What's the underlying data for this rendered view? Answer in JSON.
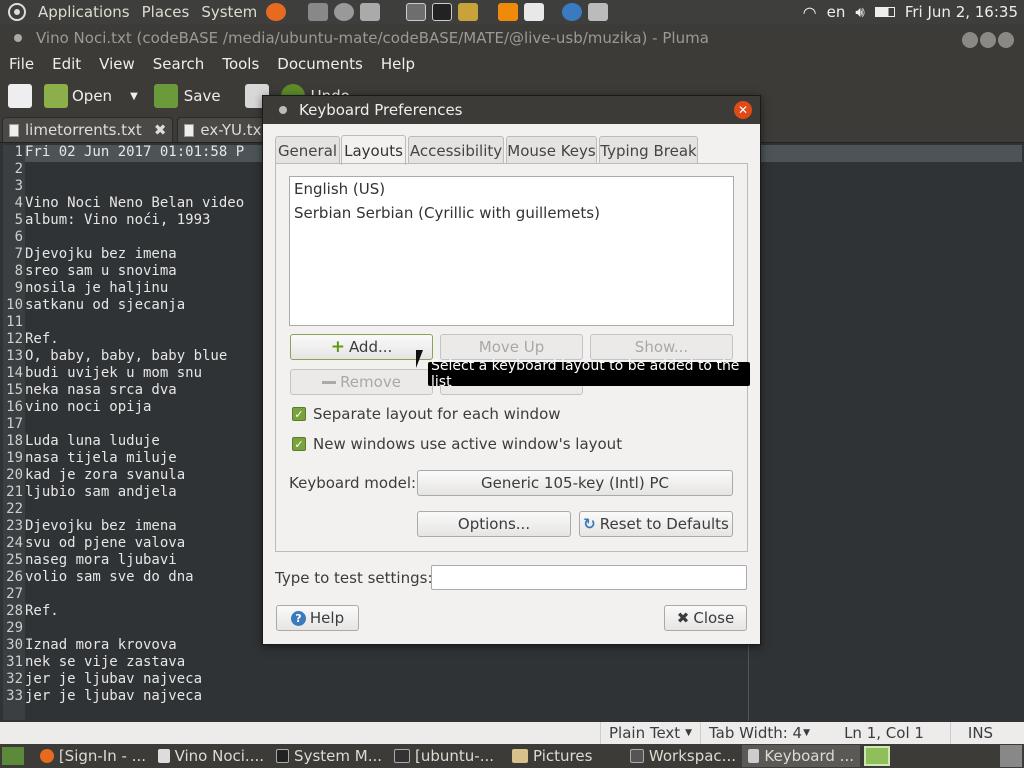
{
  "top_panel": {
    "menus": [
      "Applications",
      "Places",
      "System"
    ],
    "keyboard_layout": "en",
    "clock": "Fri Jun 2, 16:35"
  },
  "window": {
    "title": "Vino Noci.txt (codeBASE /media/ubuntu-mate/codeBASE/MATE/@live-usb/muzika) - Pluma",
    "menu": [
      "File",
      "Edit",
      "View",
      "Search",
      "Tools",
      "Documents",
      "Help"
    ],
    "toolbar": {
      "open": "Open",
      "save": "Save",
      "undo": "Undo"
    },
    "tabs": [
      "limetorrents.txt",
      "ex-YU.txt"
    ]
  },
  "editor": {
    "lines": [
      "Fri 02 Jun 2017 01:01:58 P",
      "",
      "",
      "Vino Noci Neno Belan video",
      "album: Vino noći, 1993",
      "",
      "Djevojku bez imena",
      "sreo sam u snovima",
      "nosila je haljinu",
      "satkanu od sjecanja",
      "",
      "Ref.",
      "O, baby, baby, baby blue",
      "budi uvijek u mom snu",
      "neka nasa srca dva",
      "vino noci opija",
      "",
      "Luda luna luduje",
      "nasa tijela miluje",
      "kad je zora svanula",
      "ljubio sam andjela",
      "",
      "Djevojku bez imena",
      "svu od pjene valova",
      "naseg mora ljubavi",
      "volio sam sve do dna",
      "",
      "Ref.",
      "",
      "Iznad mora krovova",
      "nek se vije zastava",
      "jer je ljubav najveca",
      "jer je ljubav najveca"
    ]
  },
  "status_bar": {
    "syntax": "Plain Text",
    "tab_width": "Tab Width: 4",
    "position": "Ln 1, Col 1",
    "mode": "INS"
  },
  "taskbar": {
    "items": [
      "[Sign-In - ...",
      "Vino Noci....",
      "System M...",
      "[ubuntu-...",
      "Pictures",
      "Workspac...",
      "Keyboard ..."
    ]
  },
  "dialog": {
    "title": "Keyboard Preferences",
    "tabs": [
      "General",
      "Layouts",
      "Accessibility",
      "Mouse Keys",
      "Typing Break"
    ],
    "active_tab": "Layouts",
    "layouts": [
      "English (US)",
      "Serbian Serbian (Cyrillic with guillemets)"
    ],
    "buttons": {
      "add": "Add...",
      "move_up": "Move Up",
      "show": "Show...",
      "remove": "Remove",
      "options": "Options...",
      "reset": "Reset to Defaults",
      "help": "Help",
      "close": "Close"
    },
    "checkboxes": {
      "separate_layout": "Separate layout for each window",
      "new_windows": "New windows use active window's layout"
    },
    "keyboard_model_label": "Keyboard model:",
    "keyboard_model_value": "Generic 105-key (Intl) PC",
    "test_label": "Type to test settings:",
    "tooltip": "Select a keyboard layout to be added to the list"
  },
  "colors": {
    "accent_green": "#7ba33d",
    "close_orange": "#df4a16",
    "panel_dark": "#3c3b37"
  }
}
